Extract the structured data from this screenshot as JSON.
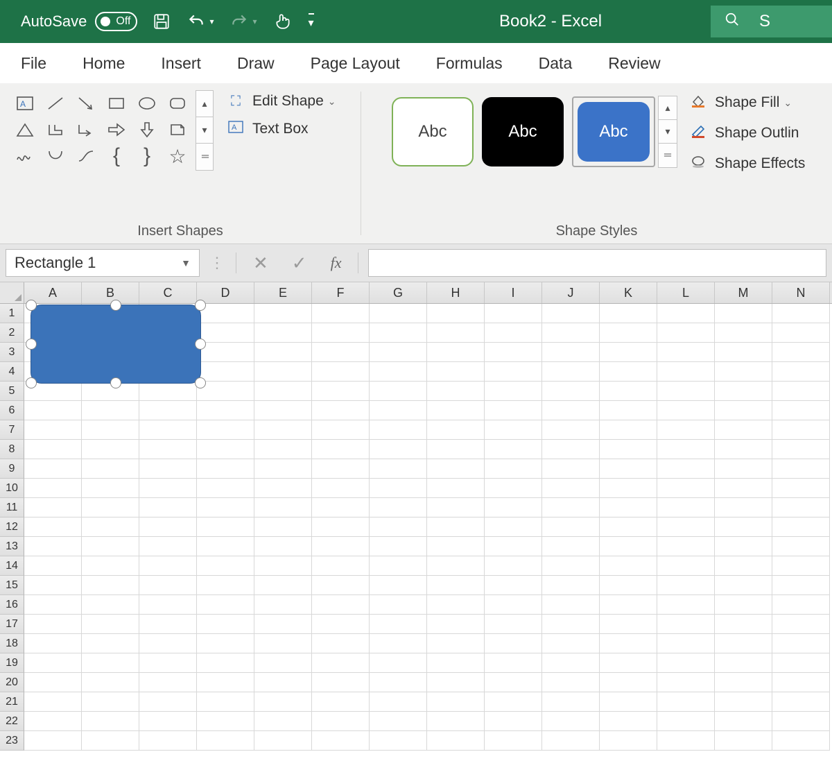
{
  "titlebar": {
    "autosave": "AutoSave",
    "autosave_state": "Off",
    "file_title": "Book2  -  Excel",
    "search_placeholder": "S"
  },
  "tabs": [
    "File",
    "Home",
    "Insert",
    "Draw",
    "Page Layout",
    "Formulas",
    "Data",
    "Review"
  ],
  "ribbon": {
    "insert_shapes_label": "Insert Shapes",
    "edit_shape": "Edit Shape",
    "text_box": "Text Box",
    "shape_styles_label": "Shape Styles",
    "swatch_text": "Abc",
    "shape_fill": "Shape Fill",
    "shape_outline": "Shape Outlin",
    "shape_effects": "Shape Effects"
  },
  "fx": {
    "namebox": "Rectangle 1",
    "fx": "fx"
  },
  "grid": {
    "cols": [
      "A",
      "B",
      "C",
      "D",
      "E",
      "F",
      "G",
      "H",
      "I",
      "J",
      "K",
      "L",
      "M",
      "N"
    ],
    "rows": [
      "1",
      "2",
      "3",
      "4",
      "5",
      "6",
      "7",
      "8",
      "9",
      "10",
      "11",
      "12",
      "13",
      "14",
      "15",
      "16",
      "17",
      "18",
      "19",
      "20",
      "21",
      "22",
      "23"
    ]
  }
}
